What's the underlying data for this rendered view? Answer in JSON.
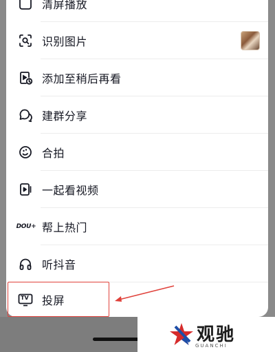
{
  "menu": {
    "items": [
      {
        "label": "清屏播放",
        "icon": "clear-screen-icon"
      },
      {
        "label": "识别图片",
        "icon": "scan-image-icon"
      },
      {
        "label": "添加至稍后再看",
        "icon": "watch-later-icon"
      },
      {
        "label": "建群分享",
        "icon": "group-share-icon"
      },
      {
        "label": "合拍",
        "icon": "duet-icon"
      },
      {
        "label": "一起看视频",
        "icon": "watch-together-icon"
      },
      {
        "label": "帮上热门",
        "icon": "dou-plus-icon",
        "icon_text": "DOU+"
      },
      {
        "label": "听抖音",
        "icon": "headphones-icon"
      },
      {
        "label": "投屏",
        "icon": "tv-cast-icon",
        "icon_text": "TV"
      }
    ]
  },
  "annotation": {
    "highlight_color": "#e0413a"
  },
  "watermark": {
    "text": "观驰",
    "subtext": "GUANCHI"
  }
}
